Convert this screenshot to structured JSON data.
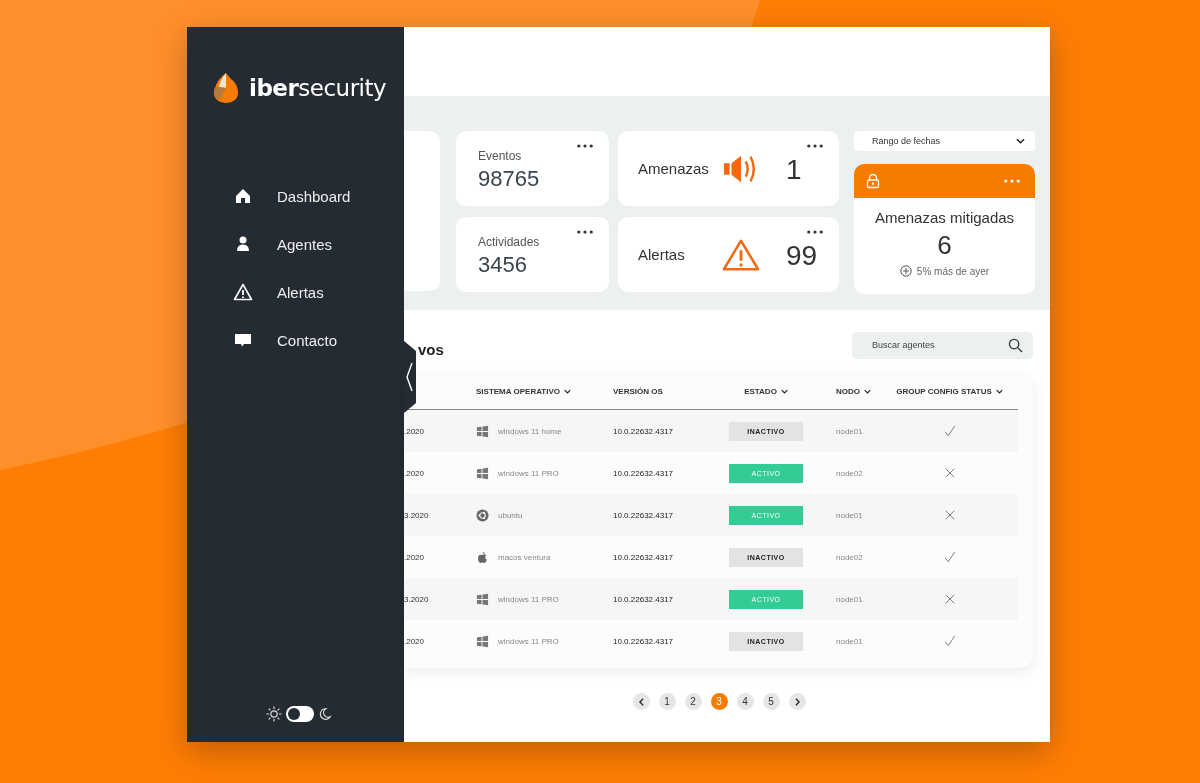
{
  "sidebar": {
    "logo": "**iber**security",
    "items": [
      {
        "label": "Dashboard",
        "kind": "home"
      },
      {
        "label": "Agentes",
        "kind": "user"
      },
      {
        "label": "Alertas",
        "kind": "alert"
      },
      {
        "label": "Contacto",
        "kind": "chat"
      }
    ],
    "theme_toggle": {
      "on": false
    }
  },
  "stats": [
    {
      "label": "Eventos",
      "value": "98765"
    },
    {
      "label": "Actividades",
      "value": "3456"
    }
  ],
  "highlights": [
    {
      "label": "Amenazas",
      "value": "1",
      "kind": "speaker"
    },
    {
      "label": "Alertas",
      "value": "99",
      "kind": "warning"
    }
  ],
  "date_range": {
    "placeholder": "Rango de fechas"
  },
  "mitigated": {
    "title": "Amenazas mitigadas",
    "value": "6",
    "note": "5% más de ayer"
  },
  "agents": {
    "title": "vos",
    "search": {
      "placeholder": "Buscar agentes"
    },
    "columns": [
      {
        "label": "SISTEMA OPERATIVO",
        "sortable": true
      },
      {
        "label": "VERSIÓN OS",
        "sortable": false
      },
      {
        "label": "ESTADO",
        "sortable": true
      },
      {
        "label": "NODO",
        "sortable": true
      },
      {
        "label": "GROUP CONFIG STATUS",
        "sortable": true
      }
    ],
    "rows": [
      {
        "date": ".2020",
        "kind": "windows",
        "os": "windows 11 home",
        "version": "10.0.22632.4317",
        "status": "INACTIVO",
        "active": false,
        "node": "node01",
        "config_ok": true
      },
      {
        "date": ".2020",
        "kind": "windows",
        "os": "windows 11 PRO",
        "version": "10.0.22632.4317",
        "status": "ACTIVO",
        "active": true,
        "node": "node02",
        "config_ok": false
      },
      {
        "date": "3.2020",
        "kind": "ubuntu",
        "os": "ubuntu",
        "version": "10.0.22632.4317",
        "status": "ACTIVO",
        "active": true,
        "node": "node01",
        "config_ok": false
      },
      {
        "date": ".2020",
        "kind": "apple",
        "os": "macos ventura",
        "version": "10.0.22632.4317",
        "status": "INACTIVO",
        "active": false,
        "node": "node02",
        "config_ok": true
      },
      {
        "date": "3.2020",
        "kind": "windows",
        "os": "windows 11 PRO",
        "version": "10.0.22632.4317",
        "status": "ACTIVO",
        "active": true,
        "node": "node01",
        "config_ok": false
      },
      {
        "date": ".2020",
        "kind": "windows",
        "os": "windows 11 PRO",
        "version": "10.0.22632.4317",
        "status": "INACTIVO",
        "active": false,
        "node": "node01",
        "config_ok": true
      }
    ]
  },
  "pagination": [
    {
      "label": "1",
      "selected": false
    },
    {
      "label": "2",
      "selected": false
    },
    {
      "label": "3",
      "selected": true
    },
    {
      "label": "4",
      "selected": false
    },
    {
      "label": "5",
      "selected": false
    }
  ]
}
